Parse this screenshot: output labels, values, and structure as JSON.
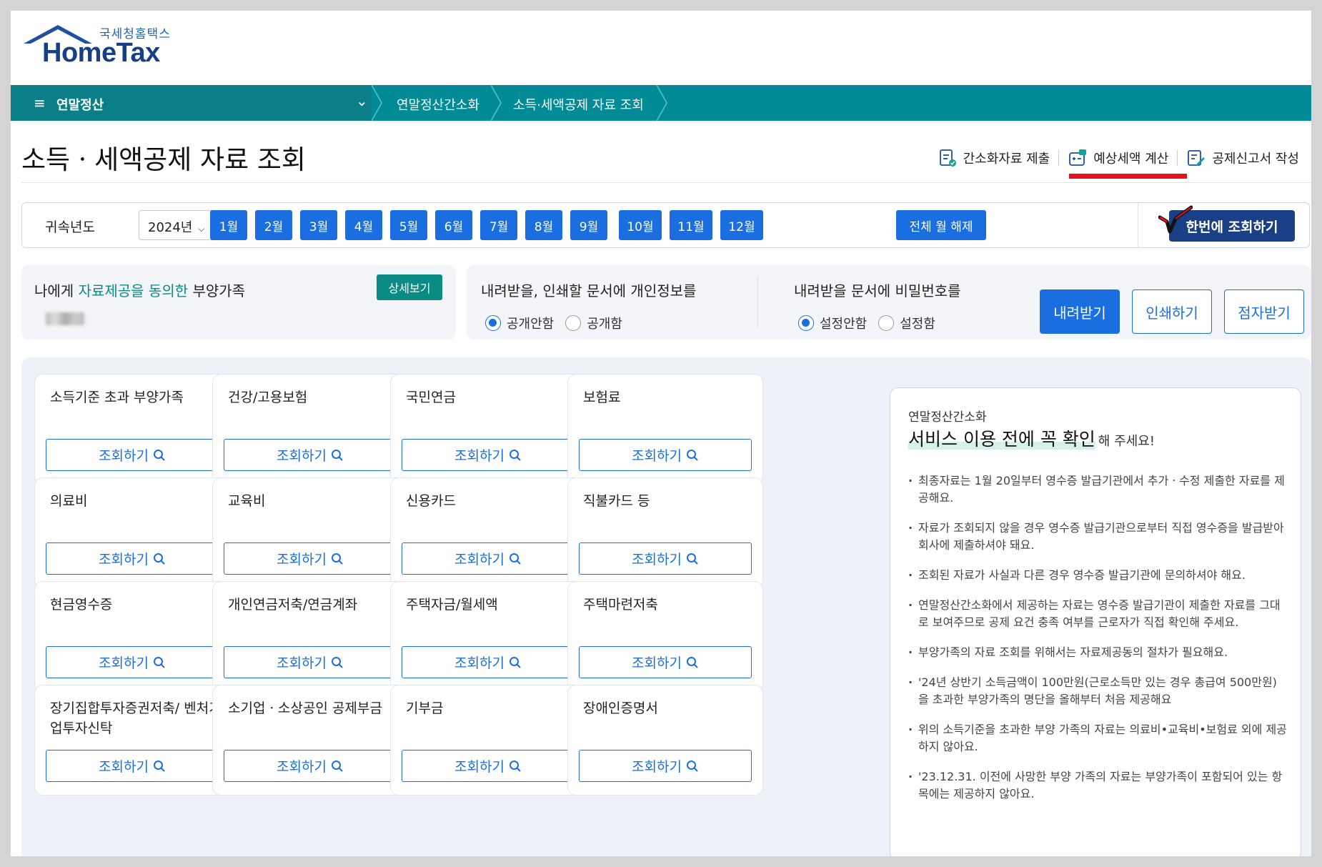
{
  "logo": {
    "sub": "국세청홈택스",
    "main": "HomeTax"
  },
  "nav": {
    "menu": "연말정산",
    "crumbs": [
      "연말정산간소화",
      "소득·세액공제 자료 조회"
    ]
  },
  "page_title": "소득ㆍ세액공제 자료 조회",
  "quick_links": [
    {
      "label": "간소화자료 제출",
      "icon": "document-check-icon"
    },
    {
      "label": "예상세액 계산",
      "icon": "calculator-icon"
    },
    {
      "label": "공제신고서 작성",
      "icon": "document-edit-icon"
    }
  ],
  "filter": {
    "year_label": "귀속년도",
    "year_value": "2024년",
    "months": [
      "1월",
      "2월",
      "3월",
      "4월",
      "5월",
      "6월",
      "7월",
      "8월",
      "9월",
      "10월",
      "11월",
      "12월"
    ],
    "clear_all": "전체 월 해제",
    "search_all": "한번에 조회하기"
  },
  "dependents": {
    "title_pre": "나에게 ",
    "title_hl": "자료제공을 동의한",
    "title_post": " 부양가족",
    "detail": "상세보기"
  },
  "privacy": {
    "title": "내려받을, 인쇄할 문서에 개인정보를",
    "options": [
      "공개안함",
      "공개함"
    ],
    "selected": "공개안함"
  },
  "password": {
    "title": "내려받을 문서에 비밀번호를",
    "options": [
      "설정안함",
      "설정함"
    ],
    "selected": "설정안함"
  },
  "actions": {
    "download": "내려받기",
    "print": "인쇄하기",
    "braille": "점자받기"
  },
  "card_button": "조회하기",
  "cards": [
    "소득기준 초과 부양가족",
    "건강/고용보험",
    "국민연금",
    "보험료",
    "의료비",
    "교육비",
    "신용카드",
    "직불카드 등",
    "현금영수증",
    "개인연금저축/연금계좌",
    "주택자금/월세액",
    "주택마련저축",
    "장기집합투자증권저축/ 벤처기업투자신탁",
    "소기업ㆍ소상공인 공제부금",
    "기부금",
    "장애인증명서"
  ],
  "notice": {
    "small": "연말정산간소화",
    "big": "서비스 이용 전에 꼭 확인",
    "tail": "해 주세요!",
    "items": [
      "최종자료는 1월 20일부터 영수증 발급기관에서 추가ㆍ수정 제출한 자료를 제공해요.",
      "자료가 조회되지 않을 경우 영수증 발급기관으로부터 직접 영수증을 발급받아 회사에 제출하셔야 돼요.",
      "조회된 자료가 사실과 다른 경우 영수증 발급기관에 문의하셔야 해요.",
      "연말정산간소화에서 제공하는 자료는 영수증 발급기관이 제출한 자료를 그대로 보여주므로 공제 요건 충족 여부를 근로자가 직접 확인해 주세요.",
      "부양가족의 자료 조회를 위해서는 자료제공동의 절차가 필요해요.",
      "'24년 상반기 소득금액이 100만원(근로소득만 있는 경우 총급여 500만원)을 초과한 부양가족의 명단을 올해부터 처음 제공해요",
      "위의 소득기준을 초과한 부양 가족의 자료는 의료비•교육비•보험료 외에 제공하지 않아요.",
      "'23.12.31. 이전에 사망한 부양 가족의 자료는 부양가족이 포함되어 있는 항목에는 제공하지 않아요."
    ]
  },
  "colors": {
    "nav": "#008b96",
    "primary": "#1a6ee0",
    "navy": "#1a3f86",
    "teal": "#0a8b84",
    "highlight": "#e8101e"
  }
}
